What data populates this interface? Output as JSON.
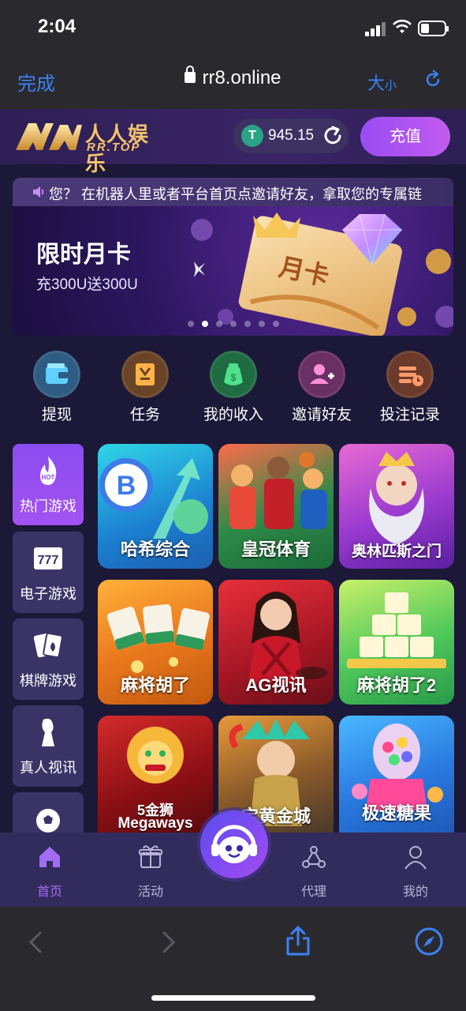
{
  "status_bar": {
    "time": "2:04"
  },
  "safari": {
    "done_label": "完成",
    "url": "rr8.online",
    "text_size_big": "大",
    "text_size_small": "小"
  },
  "header": {
    "logo_text": "人人娱乐",
    "logo_sub": "RR.TOP",
    "currency_symbol": "T",
    "balance": "945.15",
    "recharge_label": "充值"
  },
  "marquee": {
    "text": "您？ 在机器人里或者平台首页点邀请好友，拿取您的专属链"
  },
  "banner": {
    "title": "限时月卡",
    "subtitle": "充300U送300U",
    "card_text": "月卡",
    "slides": 7,
    "active_slide": 2
  },
  "quick_actions": [
    {
      "label": "提现",
      "icon": "wallet-icon"
    },
    {
      "label": "任务",
      "icon": "task-icon"
    },
    {
      "label": "我的收入",
      "icon": "money-bag-icon"
    },
    {
      "label": "邀请好友",
      "icon": "invite-user-icon"
    },
    {
      "label": "投注记录",
      "icon": "bet-record-icon"
    }
  ],
  "categories": [
    {
      "label": "热门游戏",
      "icon": "hot-flame-icon",
      "badge": "HOT",
      "active": true
    },
    {
      "label": "电子游戏",
      "icon": "slot-777-icon",
      "badge": "777"
    },
    {
      "label": "棋牌游戏",
      "icon": "cards-icon"
    },
    {
      "label": "真人视讯",
      "icon": "live-dealer-icon"
    },
    {
      "label": "",
      "icon": "soccer-ball-icon"
    }
  ],
  "games": [
    {
      "label": "哈希综合",
      "icon": "bitcoin-icon"
    },
    {
      "label": "皇冠体育",
      "icon": "sports-players-icon"
    },
    {
      "label": "奥林匹斯之门",
      "icon": "zeus-icon"
    },
    {
      "label": "麻将胡了",
      "icon": "mahjong-tiles-icon"
    },
    {
      "label": "AG视讯",
      "icon": "dealer-woman-icon"
    },
    {
      "label": "麻将胡了2",
      "icon": "mahjong-pyramid-icon"
    },
    {
      "label": "5金狮",
      "label2": "Megaways",
      "icon": "golden-lion-icon"
    },
    {
      "label": "宝黄金城",
      "icon": "aztec-princess-icon"
    },
    {
      "label": "极速糖果",
      "icon": "candy-machine-icon"
    }
  ],
  "bottom_nav": [
    {
      "label": "首页",
      "icon": "home-icon",
      "active": true
    },
    {
      "label": "活动",
      "icon": "gift-icon"
    },
    {
      "label": "代理",
      "icon": "agent-network-icon"
    },
    {
      "label": "我的",
      "icon": "profile-icon"
    }
  ],
  "colors": {
    "accent": "#a352f2",
    "bg": "#1c1838",
    "link": "#3b82f6",
    "gold": "#f3c46b"
  }
}
